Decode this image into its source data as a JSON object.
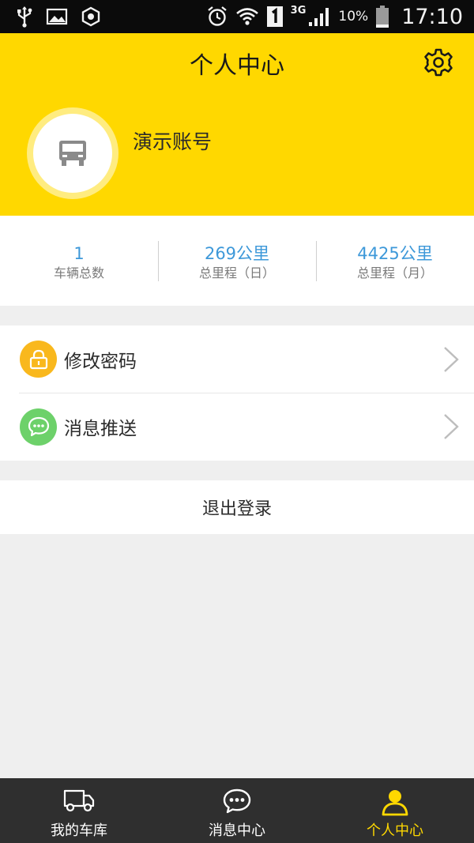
{
  "status_bar": {
    "network": "3G",
    "battery_percent": "10%",
    "time": "17:10",
    "icons": [
      "usb-icon",
      "image-icon",
      "hexagon-icon",
      "alarm-icon",
      "wifi-icon",
      "sim-1-icon",
      "signal-icon",
      "battery-icon"
    ]
  },
  "header": {
    "title": "个人中心",
    "settings_icon": "gear-icon",
    "background_color": "#ffd800"
  },
  "profile": {
    "avatar_icon": "truck-icon",
    "account_name": "演示账号"
  },
  "stats": [
    {
      "value": "1",
      "label": "车辆总数"
    },
    {
      "value": "269公里",
      "label": "总里程（日）"
    },
    {
      "value": "4425公里",
      "label": "总里程（月）"
    }
  ],
  "stats_value_color": "#3d98d9",
  "menu": [
    {
      "label": "修改密码",
      "icon": "lock-icon",
      "icon_color": "#f9b81d"
    },
    {
      "label": "消息推送",
      "icon": "chat-bubble-icon",
      "icon_color": "#6dd16a"
    }
  ],
  "logout_label": "退出登录",
  "tabbar": {
    "items": [
      {
        "label": "我的车库",
        "icon": "truck-outline-icon",
        "active": false
      },
      {
        "label": "消息中心",
        "icon": "chat-bubble-outline-icon",
        "active": false
      },
      {
        "label": "个人中心",
        "icon": "person-icon",
        "active": true
      }
    ],
    "active_color": "#ffd800"
  }
}
